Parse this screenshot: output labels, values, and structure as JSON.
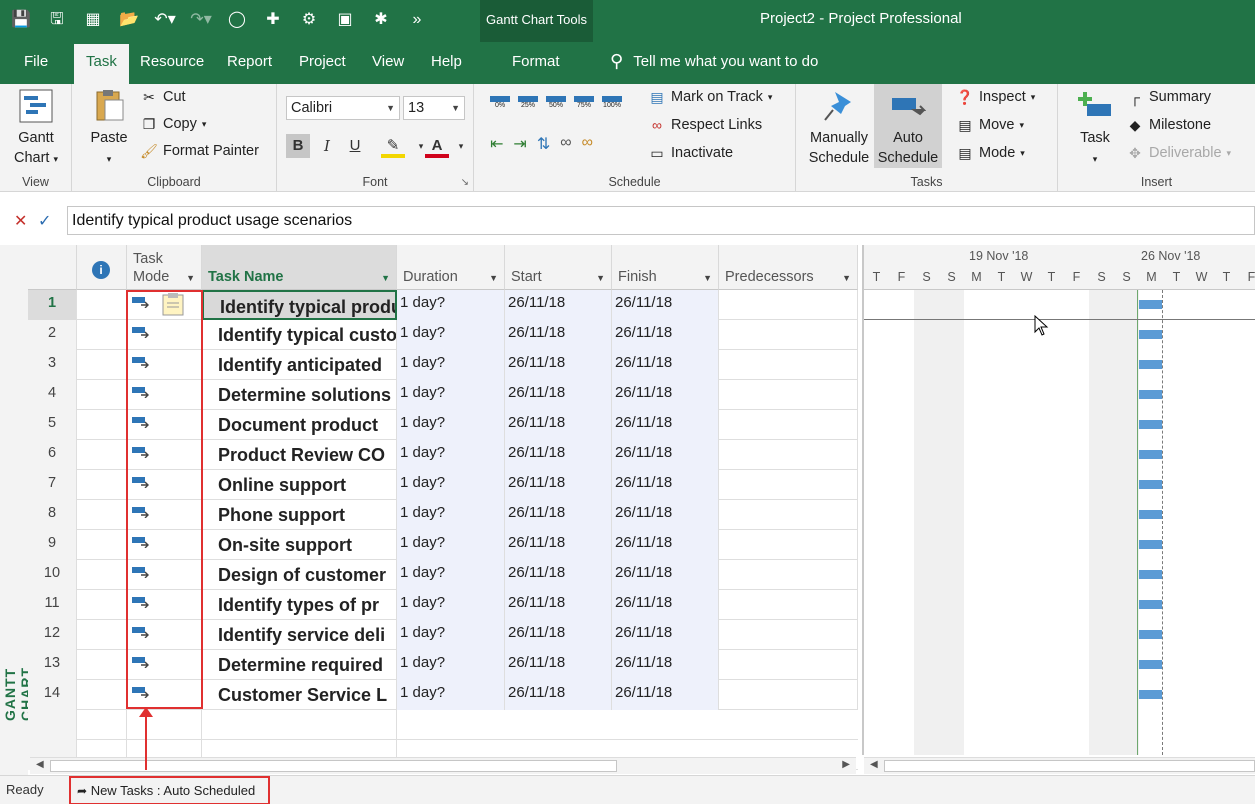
{
  "titlebar": {
    "tools_label": "Gantt Chart Tools",
    "app_title": "Project2  -  Project Professional"
  },
  "tabs": [
    "File",
    "Task",
    "Resource",
    "Report",
    "Project",
    "View",
    "Help",
    "Format"
  ],
  "active_tab": "Task",
  "tellme": "Tell me what you want to do",
  "ribbon": {
    "view": {
      "gantt_label_1": "Gantt",
      "gantt_label_2": "Chart",
      "group_label": "View"
    },
    "clipboard": {
      "paste": "Paste",
      "cut": "Cut",
      "copy": "Copy",
      "format_painter": "Format Painter",
      "group_label": "Clipboard"
    },
    "font": {
      "family": "Calibri",
      "size": "13",
      "bold": "B",
      "italic": "I",
      "underline": "U",
      "group_label": "Font"
    },
    "schedule": {
      "pct": [
        "0%",
        "25%",
        "50%",
        "75%",
        "100%"
      ],
      "mark_on_track": "Mark on Track",
      "respect_links": "Respect Links",
      "inactivate": "Inactivate",
      "group_label": "Schedule"
    },
    "tasks": {
      "manual_1": "Manually",
      "manual_2": "Schedule",
      "auto_1": "Auto",
      "auto_2": "Schedule",
      "inspect": "Inspect",
      "move": "Move",
      "mode": "Mode",
      "group_label": "Tasks"
    },
    "insert": {
      "task": "Task",
      "summary": "Summary",
      "milestone": "Milestone",
      "deliverable": "Deliverable",
      "group_label": "Insert"
    }
  },
  "formula": {
    "value": "Identify typical product usage scenarios"
  },
  "columns": {
    "task_mode_1": "Task",
    "task_mode_2": "Mode",
    "task_name": "Task Name",
    "duration": "Duration",
    "start": "Start",
    "finish": "Finish",
    "predecessors": "Predecessors"
  },
  "side_label": "GANTT CHART",
  "rows": [
    {
      "id": "1",
      "name": "Identify typical product usage scenarios",
      "duration": "1 day?",
      "start": "26/11/18",
      "finish": "26/11/18"
    },
    {
      "id": "2",
      "name": "Identify typical customers",
      "duration": "1 day?",
      "start": "26/11/18",
      "finish": "26/11/18"
    },
    {
      "id": "3",
      "name": "Identify anticipated",
      "duration": "1 day?",
      "start": "26/11/18",
      "finish": "26/11/18"
    },
    {
      "id": "4",
      "name": "Determine solutions",
      "duration": "1 day?",
      "start": "26/11/18",
      "finish": "26/11/18"
    },
    {
      "id": "5",
      "name": "Document product",
      "duration": "1 day?",
      "start": "26/11/18",
      "finish": "26/11/18"
    },
    {
      "id": "6",
      "name": "Product Review CO",
      "duration": "1 day?",
      "start": "26/11/18",
      "finish": "26/11/18"
    },
    {
      "id": "7",
      "name": "Online support",
      "duration": "1 day?",
      "start": "26/11/18",
      "finish": "26/11/18"
    },
    {
      "id": "8",
      "name": "Phone support",
      "duration": "1 day?",
      "start": "26/11/18",
      "finish": "26/11/18"
    },
    {
      "id": "9",
      "name": "On-site support",
      "duration": "1 day?",
      "start": "26/11/18",
      "finish": "26/11/18"
    },
    {
      "id": "10",
      "name": "Design of customer",
      "duration": "1 day?",
      "start": "26/11/18",
      "finish": "26/11/18"
    },
    {
      "id": "11",
      "name": "Identify types of pr",
      "duration": "1 day?",
      "start": "26/11/18",
      "finish": "26/11/18"
    },
    {
      "id": "12",
      "name": "Identify service deli",
      "duration": "1 day?",
      "start": "26/11/18",
      "finish": "26/11/18"
    },
    {
      "id": "13",
      "name": "Determine required",
      "duration": "1 day?",
      "start": "26/11/18",
      "finish": "26/11/18"
    },
    {
      "id": "14",
      "name": "Customer Service L",
      "duration": "1 day?",
      "start": "26/11/18",
      "finish": "26/11/18"
    }
  ],
  "gantt": {
    "week1": "19 Nov '18",
    "week2": "26 Nov '18",
    "days": [
      "T",
      "F",
      "S",
      "S",
      "M",
      "T",
      "W",
      "T",
      "F",
      "S",
      "S",
      "M",
      "T",
      "W",
      "T",
      "F"
    ]
  },
  "status": {
    "ready": "Ready",
    "new_tasks": "New Tasks : Auto Scheduled"
  },
  "colors": {
    "brand": "#217346",
    "bar": "#5b9bd5",
    "highlight": "#e03030"
  }
}
